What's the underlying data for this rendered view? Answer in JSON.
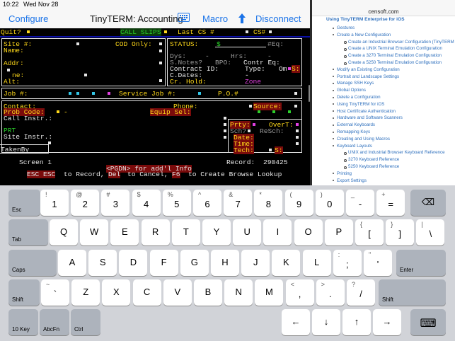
{
  "status_bar": {
    "time": "10:22",
    "date": "Wed Nov 28"
  },
  "nav": {
    "configure": "Configure",
    "title": "TinyTERM: Accounting",
    "macro": "Macro",
    "disconnect": "Disconnect"
  },
  "terminal": {
    "quit": "Quit?",
    "call_slips": "CALL SLIPS",
    "last_cs": "Last CS #",
    "cs": "CS#",
    "site": "Site #:",
    "cod_only": "COD Only:",
    "status": "STATUS:",
    "dollar": "$",
    "eq": "#Eq:",
    "name": "Name:",
    "dys": "Dys:",
    "dash1": "-",
    "hrs": "Hrs:",
    "dash2": "-",
    "addr": "Addr:",
    "s_notes": "S.Notes?",
    "bpo": "BPO:",
    "contr_eq": "Contr Eq:",
    "contract_id": "Contract ID:",
    "type": "Type:",
    "om": "Om",
    "s_flag": "S:",
    "phone_label": "ne:",
    "c_dates": "C.Dates:",
    "c_dates_dash": "-",
    "alt": "Alt:",
    "cr_hold": "Cr. Hold:",
    "zone": "Zone",
    "job": "Job #:",
    "service_job": "Service Job #:",
    "po": "P.O.#",
    "contact": "Contact:",
    "phone": "Phone:",
    "source": "Source:",
    "prob_code": "Prob Code:",
    "dash3": "-",
    "equip_sel": "Equip Sel:",
    "call_instr": "Call Instr.:",
    "prt": "PRT",
    "site_instr": "Site Instr.:",
    "prty": "Prty:",
    "overt": "OverT:",
    "sch": "Sch?",
    "resch": "ReSch:",
    "date": "Date:",
    "time": "Time:",
    "tech": "Tech:",
    "tech_s": "S:",
    "taken_by": "TakenBy",
    "screen": "Screen 1",
    "record_label": "Record:",
    "record_value": "290425",
    "pgdn": "<PGDN> for add'l Info",
    "esc_esc": "ESC ESC",
    "to_record": "to Record,",
    "del": "Del",
    "to_cancel": "to Cancel,",
    "f6": "F6",
    "to_create": "to Create Browse Lookup"
  },
  "help": {
    "domain": "censoft.com",
    "heading": "Using TinyTERM Enterprise for iOS",
    "items": [
      {
        "level": 1,
        "label": "Gestures"
      },
      {
        "level": 1,
        "label": "Create a New Configuration"
      },
      {
        "level": 2,
        "label": "Create an Industrial Browser Configuration (TinyTERM"
      },
      {
        "level": 2,
        "label": "Create a UNIX Terminal Emulation Configuration"
      },
      {
        "level": 2,
        "label": "Create a 3270 Terminal Emulation Configuration"
      },
      {
        "level": 2,
        "label": "Create a 5250 Terminal Emulation Configuration"
      },
      {
        "level": 1,
        "label": "Modify an Existing Configuration"
      },
      {
        "level": 1,
        "label": "Portrait and Landscape Settings"
      },
      {
        "level": 1,
        "label": "Manage SSH Keys"
      },
      {
        "level": 1,
        "label": "Global Options"
      },
      {
        "level": 1,
        "label": "Delete a Configuration"
      },
      {
        "level": 1,
        "label": "Using TinyTERM for iOS"
      },
      {
        "level": 1,
        "label": "Host Certificate Authentication"
      },
      {
        "level": 1,
        "label": "Hardware and Software Scanners"
      },
      {
        "level": 1,
        "label": "External Keyboards"
      },
      {
        "level": 1,
        "label": "Remapping Keys"
      },
      {
        "level": 1,
        "label": "Creating and Using Macros"
      },
      {
        "level": 1,
        "label": "Keyboard Layouts"
      },
      {
        "level": 2,
        "label": "UNIX and Industrial Browser Keyboard Reference"
      },
      {
        "level": 2,
        "label": "3270 Keyboard Reference"
      },
      {
        "level": 2,
        "label": "5250 Keyboard Reference"
      },
      {
        "level": 1,
        "label": "Printing"
      },
      {
        "level": 1,
        "label": "Export Settings"
      }
    ]
  },
  "keyboard": {
    "row1": [
      {
        "label": "",
        "side": "Esc"
      },
      {
        "label": "1",
        "sub": "!"
      },
      {
        "label": "2",
        "sub": "@"
      },
      {
        "label": "3",
        "sub": "#"
      },
      {
        "label": "4",
        "sub": "$"
      },
      {
        "label": "5",
        "sub": "%"
      },
      {
        "label": "6",
        "sub": "^"
      },
      {
        "label": "7",
        "sub": "&"
      },
      {
        "label": "8",
        "sub": "*"
      },
      {
        "label": "9",
        "sub": "("
      },
      {
        "label": "0",
        "sub": ")"
      },
      {
        "label": "-",
        "sub": "_"
      },
      {
        "label": "=",
        "sub": "+"
      },
      {
        "label": "⌫",
        "sub": ""
      }
    ],
    "row2": [
      {
        "label": "",
        "side": "Tab"
      },
      {
        "label": "Q"
      },
      {
        "label": "W"
      },
      {
        "label": "E"
      },
      {
        "label": "R"
      },
      {
        "label": "T"
      },
      {
        "label": "Y"
      },
      {
        "label": "U"
      },
      {
        "label": "I"
      },
      {
        "label": "O"
      },
      {
        "label": "P"
      },
      {
        "label": "[",
        "sub": "{"
      },
      {
        "label": "]",
        "sub": "}"
      },
      {
        "label": "\\",
        "sub": "|"
      }
    ],
    "row3": [
      {
        "label": "",
        "side": "Caps"
      },
      {
        "label": "A"
      },
      {
        "label": "S"
      },
      {
        "label": "D"
      },
      {
        "label": "F"
      },
      {
        "label": "G"
      },
      {
        "label": "H"
      },
      {
        "label": "J"
      },
      {
        "label": "K"
      },
      {
        "label": "L"
      },
      {
        "label": ";",
        "sub": ":"
      },
      {
        "label": "'",
        "sub": "\""
      },
      {
        "label": "",
        "side": "Enter"
      }
    ],
    "row4": [
      {
        "label": "",
        "side": "Shift"
      },
      {
        "label": "`",
        "sub": "~"
      },
      {
        "label": "Z"
      },
      {
        "label": "X"
      },
      {
        "label": "C"
      },
      {
        "label": "V"
      },
      {
        "label": "B"
      },
      {
        "label": "N"
      },
      {
        "label": "M"
      },
      {
        "label": ",",
        "sub": "<"
      },
      {
        "label": ".",
        "sub": ">"
      },
      {
        "label": "/",
        "sub": "?"
      },
      {
        "label": "",
        "side": "Shift"
      }
    ],
    "row5": [
      {
        "label": "",
        "side": "10 Key"
      },
      {
        "label": "",
        "side": "AbcFn"
      },
      {
        "label": "",
        "side": "Ctrl"
      },
      {
        "label": "←"
      },
      {
        "label": "↓"
      },
      {
        "label": "↑"
      },
      {
        "label": "→"
      },
      {
        "label": "⌨"
      }
    ]
  }
}
